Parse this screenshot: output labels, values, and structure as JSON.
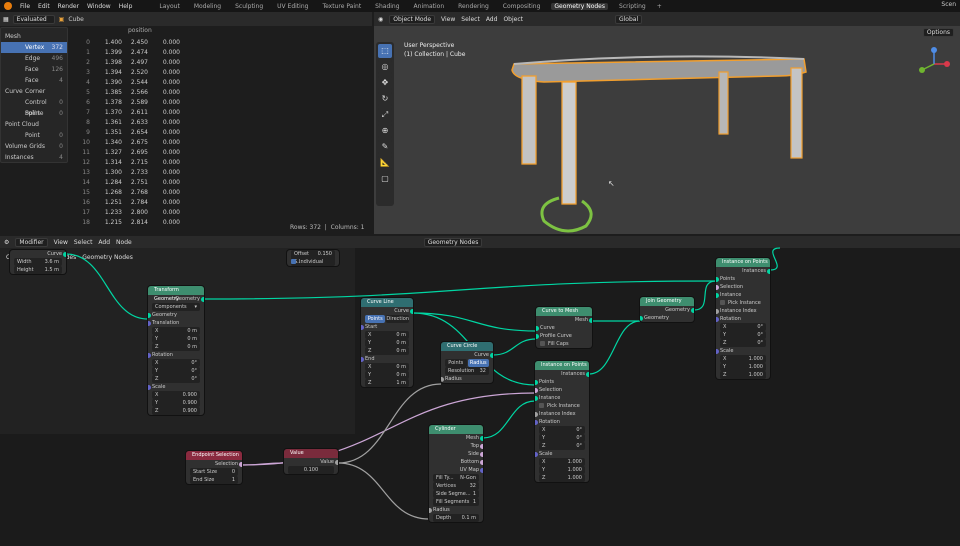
{
  "menus": [
    "File",
    "Edit",
    "Render",
    "Window",
    "Help"
  ],
  "workspaces": [
    {
      "label": "Layout",
      "active": false
    },
    {
      "label": "Modeling",
      "active": false
    },
    {
      "label": "Sculpting",
      "active": false
    },
    {
      "label": "UV Editing",
      "active": false
    },
    {
      "label": "Texture Paint",
      "active": false
    },
    {
      "label": "Shading",
      "active": false
    },
    {
      "label": "Animation",
      "active": false
    },
    {
      "label": "Rendering",
      "active": false
    },
    {
      "label": "Compositing",
      "active": false
    },
    {
      "label": "Geometry Nodes",
      "active": true
    },
    {
      "label": "Scripting",
      "active": false
    }
  ],
  "top_right": "Scen",
  "spreadsheet": {
    "mode": "Evaluated",
    "object": "Cube",
    "outline": [
      {
        "label": "Mesh",
        "count": ""
      },
      {
        "label": "Vertex",
        "count": "372",
        "selected": true
      },
      {
        "label": "Edge",
        "count": "496"
      },
      {
        "label": "Face",
        "count": "126"
      },
      {
        "label": "Face Corner",
        "count": "4"
      },
      {
        "label": "Curve",
        "count": ""
      },
      {
        "label": "Control Point",
        "count": "0"
      },
      {
        "label": "Spline",
        "count": "0"
      },
      {
        "label": "Point Cloud",
        "count": ""
      },
      {
        "label": "Point",
        "count": "0"
      },
      {
        "label": "Volume Grids",
        "count": "0"
      },
      {
        "label": "Instances",
        "count": "4"
      }
    ],
    "column": "position",
    "rows": [
      [
        "0",
        "1.400",
        "2.450",
        "0.000"
      ],
      [
        "1",
        "1.399",
        "2.474",
        "0.000"
      ],
      [
        "2",
        "1.398",
        "2.497",
        "0.000"
      ],
      [
        "3",
        "1.394",
        "2.520",
        "0.000"
      ],
      [
        "4",
        "1.390",
        "2.544",
        "0.000"
      ],
      [
        "5",
        "1.385",
        "2.566",
        "0.000"
      ],
      [
        "6",
        "1.378",
        "2.589",
        "0.000"
      ],
      [
        "7",
        "1.370",
        "2.611",
        "0.000"
      ],
      [
        "8",
        "1.361",
        "2.633",
        "0.000"
      ],
      [
        "9",
        "1.351",
        "2.654",
        "0.000"
      ],
      [
        "10",
        "1.340",
        "2.675",
        "0.000"
      ],
      [
        "11",
        "1.327",
        "2.695",
        "0.000"
      ],
      [
        "12",
        "1.314",
        "2.715",
        "0.000"
      ],
      [
        "13",
        "1.300",
        "2.733",
        "0.000"
      ],
      [
        "14",
        "1.284",
        "2.751",
        "0.000"
      ],
      [
        "15",
        "1.268",
        "2.768",
        "0.000"
      ],
      [
        "16",
        "1.251",
        "2.784",
        "0.000"
      ],
      [
        "17",
        "1.233",
        "2.800",
        "0.000"
      ],
      [
        "18",
        "1.215",
        "2.814",
        "0.000"
      ]
    ],
    "status_rows": "Rows: 372",
    "status_cols": "Columns: 1"
  },
  "viewport": {
    "mode": "Object Mode",
    "menus": [
      "View",
      "Select",
      "Add",
      "Object"
    ],
    "perspective": "User Perspective",
    "collection": "(1) Collection | Cube",
    "orientation": "Global",
    "options": "Options"
  },
  "node_editor": {
    "editor": "Modifier",
    "menus": [
      "View",
      "Select",
      "Add",
      "Node"
    ],
    "tree": "Geometry Nodes",
    "breadcrumb": [
      "Cube",
      "GeometryNodes",
      "Geometry Nodes"
    ]
  },
  "nodes": {
    "curve_line_top": {
      "socket": "Curve",
      "width": "Width",
      "width_val": "3.6 m",
      "height": "Height",
      "height_val": "1.5 m"
    },
    "offset": {
      "label": "Offset S...",
      "val": "0.150",
      "individual": "Individual"
    },
    "transform": {
      "title": "Transform Geometry",
      "geometry_out": "Geometry",
      "mode": "Components",
      "geometry_in": "Geometry",
      "translation": "Translation",
      "tx": "X",
      "tx_v": "0 m",
      "ty": "Y",
      "ty_v": "0 m",
      "tz": "Z",
      "tz_v": "0 m",
      "rotation": "Rotation",
      "rx": "X",
      "rx_v": "0°",
      "ry": "Y",
      "ry_v": "0°",
      "rz": "Z",
      "rz_v": "0°",
      "scale": "Scale",
      "sx": "X",
      "sx_v": "0.900",
      "sy": "Y",
      "sy_v": "0.900",
      "sz": "Z",
      "sz_v": "0.900"
    },
    "curve_line": {
      "title": "Curve Line",
      "curve": "Curve",
      "points": "Points",
      "direction": "Direction",
      "start": "Start",
      "sx": "X",
      "sx_v": "0 m",
      "sy": "Y",
      "sy_v": "0 m",
      "sz": "Z",
      "sz_v": "0 m",
      "end": "End",
      "ex": "X",
      "ex_v": "0 m",
      "ey": "Y",
      "ey_v": "0 m",
      "ez": "Z",
      "ez_v": "1 m"
    },
    "curve_circle": {
      "title": "Curve Circle",
      "curve": "Curve",
      "points": "Points",
      "radius_btn": "Radius",
      "resolution": "Resolution",
      "res_v": "32",
      "radius": "Radius"
    },
    "curve_to_mesh": {
      "title": "Curve to Mesh",
      "mesh": "Mesh",
      "curve": "Curve",
      "profile": "Profile Curve",
      "fill": "Fill Caps"
    },
    "join": {
      "title": "Join Geometry",
      "geometry_out": "Geometry",
      "geometry_in": "Geometry"
    },
    "iop1": {
      "title": "Instance on Points",
      "instances": "Instances",
      "points": "Points",
      "selection": "Selection",
      "instance": "Instance",
      "pick": "Pick Instance",
      "index": "Instance Index",
      "rotation": "Rotation",
      "rx": "X",
      "rx_v": "0°",
      "ry": "Y",
      "ry_v": "0°",
      "rz": "Z",
      "rz_v": "0°",
      "scale": "Scale",
      "sx": "X",
      "sx_v": "1.000",
      "sy": "Y",
      "sy_v": "1.000",
      "sz": "Z",
      "sz_v": "1.000"
    },
    "iop2": {
      "title": "Instance on Points",
      "instances": "Instances",
      "points": "Points",
      "selection": "Selection",
      "instance": "Instance",
      "pick": "Pick Instance",
      "index": "Instance Index",
      "rotation": "Rotation",
      "rx": "X",
      "rx_v": "0°",
      "ry": "Y",
      "ry_v": "0°",
      "rz": "Z",
      "rz_v": "0°",
      "scale": "Scale",
      "sx": "X",
      "sx_v": "1.000",
      "sy": "Y",
      "sy_v": "1.000",
      "sz": "Z",
      "sz_v": "1.000"
    },
    "endpoint": {
      "title": "Endpoint Selection",
      "selection": "Selection",
      "start": "Start Size",
      "start_v": "0",
      "end": "End Size",
      "end_v": "1"
    },
    "value": {
      "title": "Value",
      "value": "Value",
      "v": "0.100"
    },
    "cylinder": {
      "title": "Cylinder",
      "mesh": "Mesh",
      "top": "Top",
      "side": "Side",
      "bottom": "Bottom",
      "uv": "UV Map",
      "fill": "Fill Ty...",
      "fill_v": "N-Gon",
      "vertices": "Vertices",
      "vertices_v": "32",
      "side_seg": "Side Segme...",
      "side_seg_v": "1",
      "fill_seg": "Fill Segments",
      "fill_seg_v": "1",
      "radius": "Radius",
      "depth": "Depth",
      "depth_v": "0.1 m"
    }
  }
}
